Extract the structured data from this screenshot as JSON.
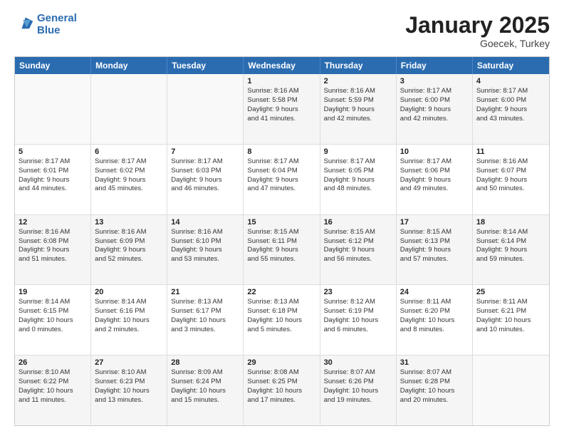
{
  "header": {
    "logo_line1": "General",
    "logo_line2": "Blue",
    "month": "January 2025",
    "location": "Goecek, Turkey"
  },
  "weekdays": [
    "Sunday",
    "Monday",
    "Tuesday",
    "Wednesday",
    "Thursday",
    "Friday",
    "Saturday"
  ],
  "rows": [
    [
      {
        "day": "",
        "text": ""
      },
      {
        "day": "",
        "text": ""
      },
      {
        "day": "",
        "text": ""
      },
      {
        "day": "1",
        "text": "Sunrise: 8:16 AM\nSunset: 5:58 PM\nDaylight: 9 hours\nand 41 minutes."
      },
      {
        "day": "2",
        "text": "Sunrise: 8:16 AM\nSunset: 5:59 PM\nDaylight: 9 hours\nand 42 minutes."
      },
      {
        "day": "3",
        "text": "Sunrise: 8:17 AM\nSunset: 6:00 PM\nDaylight: 9 hours\nand 42 minutes."
      },
      {
        "day": "4",
        "text": "Sunrise: 8:17 AM\nSunset: 6:00 PM\nDaylight: 9 hours\nand 43 minutes."
      }
    ],
    [
      {
        "day": "5",
        "text": "Sunrise: 8:17 AM\nSunset: 6:01 PM\nDaylight: 9 hours\nand 44 minutes."
      },
      {
        "day": "6",
        "text": "Sunrise: 8:17 AM\nSunset: 6:02 PM\nDaylight: 9 hours\nand 45 minutes."
      },
      {
        "day": "7",
        "text": "Sunrise: 8:17 AM\nSunset: 6:03 PM\nDaylight: 9 hours\nand 46 minutes."
      },
      {
        "day": "8",
        "text": "Sunrise: 8:17 AM\nSunset: 6:04 PM\nDaylight: 9 hours\nand 47 minutes."
      },
      {
        "day": "9",
        "text": "Sunrise: 8:17 AM\nSunset: 6:05 PM\nDaylight: 9 hours\nand 48 minutes."
      },
      {
        "day": "10",
        "text": "Sunrise: 8:17 AM\nSunset: 6:06 PM\nDaylight: 9 hours\nand 49 minutes."
      },
      {
        "day": "11",
        "text": "Sunrise: 8:16 AM\nSunset: 6:07 PM\nDaylight: 9 hours\nand 50 minutes."
      }
    ],
    [
      {
        "day": "12",
        "text": "Sunrise: 8:16 AM\nSunset: 6:08 PM\nDaylight: 9 hours\nand 51 minutes."
      },
      {
        "day": "13",
        "text": "Sunrise: 8:16 AM\nSunset: 6:09 PM\nDaylight: 9 hours\nand 52 minutes."
      },
      {
        "day": "14",
        "text": "Sunrise: 8:16 AM\nSunset: 6:10 PM\nDaylight: 9 hours\nand 53 minutes."
      },
      {
        "day": "15",
        "text": "Sunrise: 8:15 AM\nSunset: 6:11 PM\nDaylight: 9 hours\nand 55 minutes."
      },
      {
        "day": "16",
        "text": "Sunrise: 8:15 AM\nSunset: 6:12 PM\nDaylight: 9 hours\nand 56 minutes."
      },
      {
        "day": "17",
        "text": "Sunrise: 8:15 AM\nSunset: 6:13 PM\nDaylight: 9 hours\nand 57 minutes."
      },
      {
        "day": "18",
        "text": "Sunrise: 8:14 AM\nSunset: 6:14 PM\nDaylight: 9 hours\nand 59 minutes."
      }
    ],
    [
      {
        "day": "19",
        "text": "Sunrise: 8:14 AM\nSunset: 6:15 PM\nDaylight: 10 hours\nand 0 minutes."
      },
      {
        "day": "20",
        "text": "Sunrise: 8:14 AM\nSunset: 6:16 PM\nDaylight: 10 hours\nand 2 minutes."
      },
      {
        "day": "21",
        "text": "Sunrise: 8:13 AM\nSunset: 6:17 PM\nDaylight: 10 hours\nand 3 minutes."
      },
      {
        "day": "22",
        "text": "Sunrise: 8:13 AM\nSunset: 6:18 PM\nDaylight: 10 hours\nand 5 minutes."
      },
      {
        "day": "23",
        "text": "Sunrise: 8:12 AM\nSunset: 6:19 PM\nDaylight: 10 hours\nand 6 minutes."
      },
      {
        "day": "24",
        "text": "Sunrise: 8:11 AM\nSunset: 6:20 PM\nDaylight: 10 hours\nand 8 minutes."
      },
      {
        "day": "25",
        "text": "Sunrise: 8:11 AM\nSunset: 6:21 PM\nDaylight: 10 hours\nand 10 minutes."
      }
    ],
    [
      {
        "day": "26",
        "text": "Sunrise: 8:10 AM\nSunset: 6:22 PM\nDaylight: 10 hours\nand 11 minutes."
      },
      {
        "day": "27",
        "text": "Sunrise: 8:10 AM\nSunset: 6:23 PM\nDaylight: 10 hours\nand 13 minutes."
      },
      {
        "day": "28",
        "text": "Sunrise: 8:09 AM\nSunset: 6:24 PM\nDaylight: 10 hours\nand 15 minutes."
      },
      {
        "day": "29",
        "text": "Sunrise: 8:08 AM\nSunset: 6:25 PM\nDaylight: 10 hours\nand 17 minutes."
      },
      {
        "day": "30",
        "text": "Sunrise: 8:07 AM\nSunset: 6:26 PM\nDaylight: 10 hours\nand 19 minutes."
      },
      {
        "day": "31",
        "text": "Sunrise: 8:07 AM\nSunset: 6:28 PM\nDaylight: 10 hours\nand 20 minutes."
      },
      {
        "day": "",
        "text": ""
      }
    ]
  ]
}
